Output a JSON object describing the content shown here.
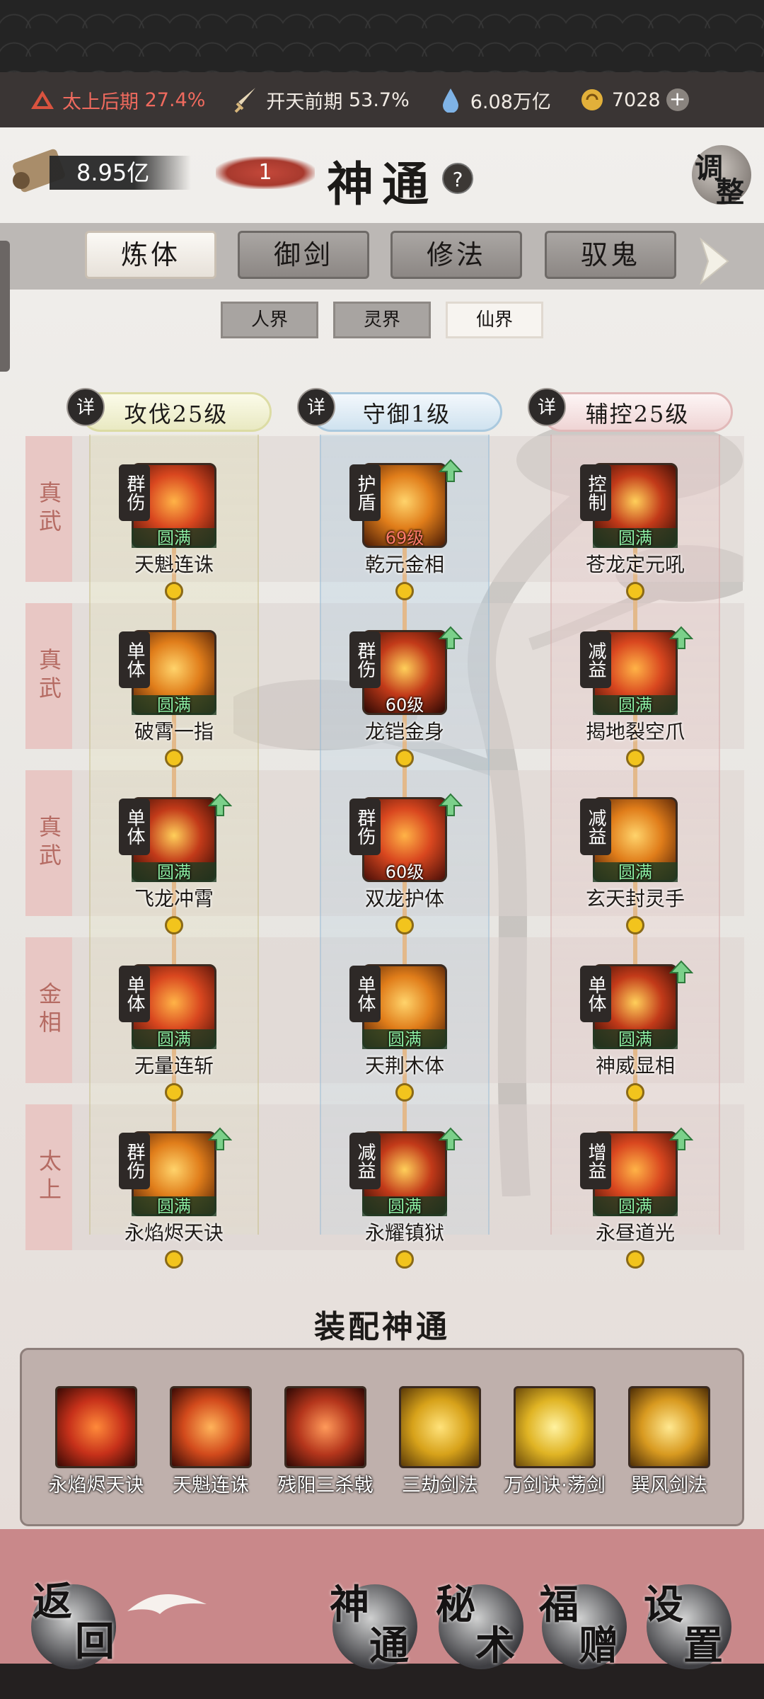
{
  "resources": {
    "realm_1": {
      "name": "太上后期",
      "pct": "27.4%"
    },
    "realm_2": {
      "name": "开天前期",
      "pct": "53.7%"
    },
    "spirit_stones": "6.08万亿",
    "jade": "7028"
  },
  "header": {
    "money": "8.95亿",
    "count": "1",
    "title": "神通",
    "help": "?",
    "adjust_1": "调",
    "adjust_2": "整"
  },
  "main_tabs": [
    "炼体",
    "御剑",
    "修法",
    "驭鬼"
  ],
  "realm_tabs": [
    "人界",
    "灵界",
    "仙界"
  ],
  "columns": [
    {
      "detail": "详",
      "label": "攻伐25级"
    },
    {
      "detail": "详",
      "label": "守御1级"
    },
    {
      "detail": "详",
      "label": "辅控25级"
    }
  ],
  "rows": [
    {
      "label": "真武",
      "skills": [
        {
          "tag": "群伤",
          "level": "圆满",
          "name": "天魁连诛",
          "up": false
        },
        {
          "tag": "护盾",
          "level": "69级",
          "name": "乾元金相",
          "up": true
        },
        {
          "tag": "控制",
          "level": "圆满",
          "name": "苍龙定元吼",
          "up": false
        }
      ]
    },
    {
      "label": "真武",
      "skills": [
        {
          "tag": "单体",
          "level": "圆满",
          "name": "破霄一指",
          "up": false
        },
        {
          "tag": "群伤",
          "level": "60级",
          "name": "龙铠金身",
          "up": true
        },
        {
          "tag": "减益",
          "level": "圆满",
          "name": "揭地裂空爪",
          "up": true
        }
      ]
    },
    {
      "label": "真武",
      "skills": [
        {
          "tag": "单体",
          "level": "圆满",
          "name": "飞龙冲霄",
          "up": true
        },
        {
          "tag": "群伤",
          "level": "60级",
          "name": "双龙护体",
          "up": true
        },
        {
          "tag": "减益",
          "level": "圆满",
          "name": "玄天封灵手",
          "up": false
        }
      ]
    },
    {
      "label": "金相",
      "skills": [
        {
          "tag": "单体",
          "level": "圆满",
          "name": "无量连斩",
          "up": false
        },
        {
          "tag": "单体",
          "level": "圆满",
          "name": "天荆木体",
          "up": false
        },
        {
          "tag": "单体",
          "level": "圆满",
          "name": "神威显相",
          "up": true
        }
      ]
    },
    {
      "label": "太上",
      "skills": [
        {
          "tag": "群伤",
          "level": "圆满",
          "name": "永焰烬天诀",
          "up": true
        },
        {
          "tag": "减益",
          "level": "圆满",
          "name": "永耀镇狱",
          "up": true
        },
        {
          "tag": "增益",
          "level": "圆满",
          "name": "永昼道光",
          "up": true
        }
      ]
    }
  ],
  "equip": {
    "title": "装配神通",
    "slots": [
      "永焰烬天诀",
      "天魁连诛",
      "残阳三杀戟",
      "三劫剑法",
      "万剑诀·荡剑",
      "巽风剑法"
    ]
  },
  "bottom_nav": {
    "back": [
      "返",
      "回"
    ],
    "shentong": [
      "神",
      "通"
    ],
    "mishu": [
      "秘",
      "术"
    ],
    "fuzeng": [
      "福",
      "赠"
    ],
    "shezhi": [
      "设",
      "置"
    ]
  },
  "colors": {
    "accent_red": "#ef6a5e",
    "gold": "#f2c41d",
    "complete_green": "#8ef0a4"
  }
}
